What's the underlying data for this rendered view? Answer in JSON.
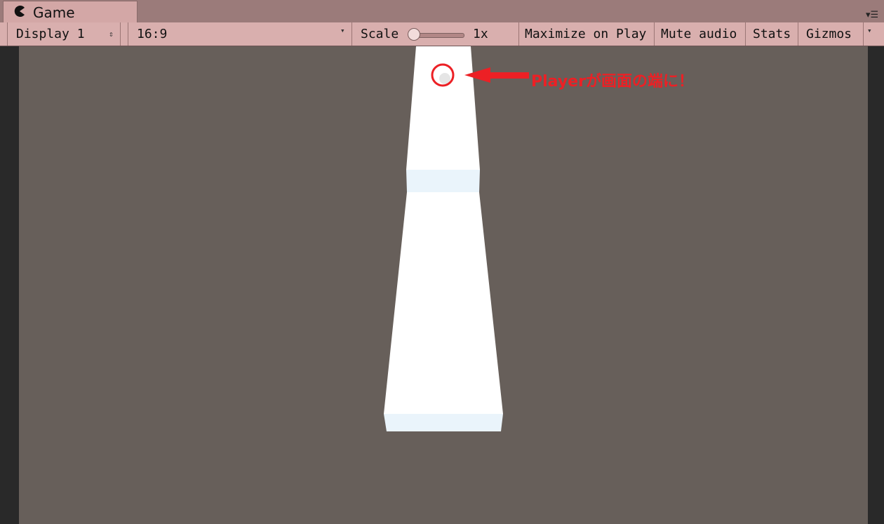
{
  "tab": {
    "title": "Game",
    "icon": "unity-game-icon"
  },
  "toolbar": {
    "display": "Display 1",
    "aspect": "16:9",
    "scale_label": "Scale",
    "scale_value": "1x",
    "maximize_on_play": "Maximize on Play",
    "mute_audio": "Mute audio",
    "stats": "Stats",
    "gizmos": "Gizmos"
  },
  "annotation": {
    "text": "Playerが画面の端に！",
    "color": "#ec2025"
  },
  "colors": {
    "toolbar_bg": "#d9afae",
    "game_bg": "#675f5a",
    "platform": "#ffffff",
    "platform_shade": "#eaf4fb"
  }
}
